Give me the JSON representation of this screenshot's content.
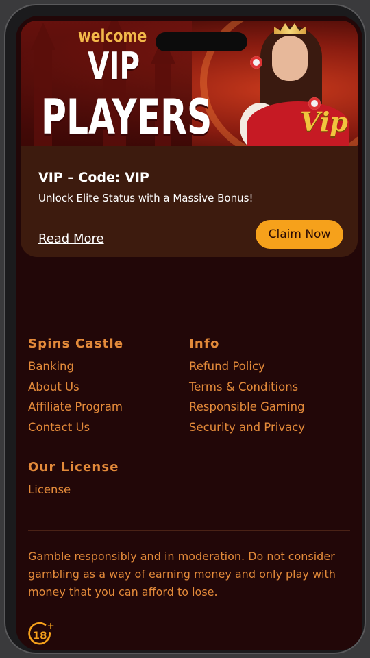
{
  "promo": {
    "banner_welcome": "welcome",
    "banner_vip": "VIP",
    "banner_players": "PLAYERS",
    "banner_logo": "Vip",
    "title": "VIP – Code: VIP",
    "subtitle": "Unlock Elite Status with a Massive Bonus!",
    "read_more": "Read More",
    "claim": "Claim Now"
  },
  "footer": {
    "spins_castle": {
      "heading": "Spins Castle",
      "links": [
        "Banking",
        "About Us",
        "Affiliate Program",
        "Contact Us"
      ]
    },
    "info": {
      "heading": "Info",
      "links": [
        "Refund Policy",
        "Terms & Conditions",
        "Responsible Gaming",
        "Security and Privacy"
      ]
    },
    "license": {
      "heading": "Our License",
      "links": [
        "License"
      ]
    },
    "disclaimer": "Gamble responsibly and in moderation. Do not consider gambling as a way of earning money and only play with money that you can afford to lose.",
    "age_badge": "18+"
  },
  "colors": {
    "background": "#220708",
    "card": "#3d1b0e",
    "accent": "#e38a3a",
    "button": "#f6a11b"
  }
}
